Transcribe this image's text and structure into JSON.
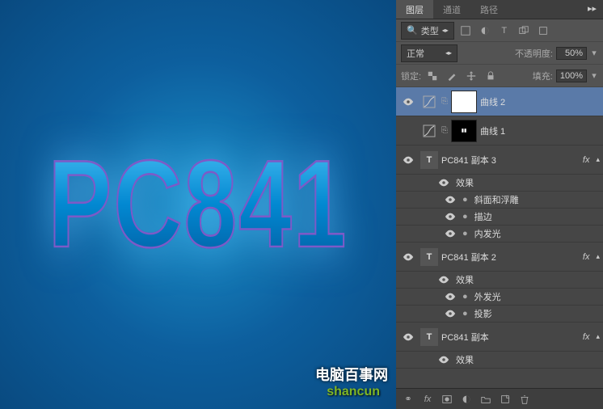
{
  "canvas": {
    "text": "PC841",
    "watermark1": "电脑百事网",
    "watermark2": "shancun"
  },
  "tabs": {
    "layers": "图层",
    "channels": "通道",
    "paths": "路径"
  },
  "filter_row": {
    "kind_label": "类型"
  },
  "blend_row": {
    "mode": "正常",
    "opacity_label": "不透明度:",
    "opacity_value": "50%"
  },
  "lock_row": {
    "lock_label": "锁定:",
    "fill_label": "填充:",
    "fill_value": "100%"
  },
  "layers": [
    {
      "type": "adjustment",
      "name": "曲线 2",
      "thumb": "white",
      "selected": true,
      "visible": true
    },
    {
      "type": "adjustment",
      "name": "曲线 1",
      "thumb": "curves1",
      "visible": false
    },
    {
      "type": "text",
      "name": "PC841 副本 3",
      "fx": true,
      "visible": true,
      "effects_label": "效果",
      "effects": [
        "斜面和浮雕",
        "描边",
        "内发光"
      ]
    },
    {
      "type": "text",
      "name": "PC841 副本 2",
      "fx": true,
      "visible": true,
      "effects_label": "效果",
      "effects": [
        "外发光",
        "投影"
      ]
    },
    {
      "type": "text",
      "name": "PC841 副本",
      "fx": true,
      "visible": true,
      "effects_label": "效果",
      "effects": []
    }
  ],
  "fx_text": "fx"
}
